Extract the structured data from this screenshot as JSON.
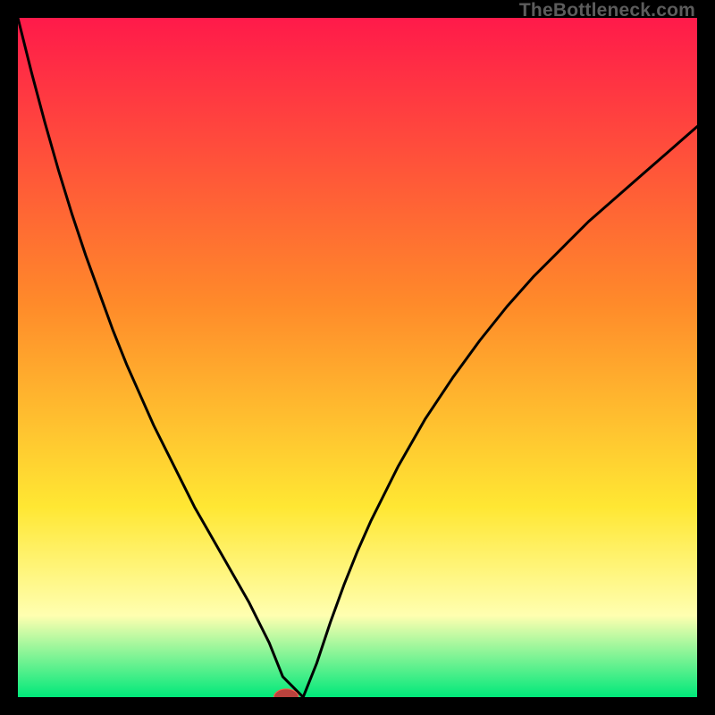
{
  "watermark": "TheBottleneck.com",
  "colors": {
    "gradient_top": "#ff1a4a",
    "gradient_mid1": "#ff8a2a",
    "gradient_mid2": "#ffe733",
    "gradient_paleyellow": "#ffffb0",
    "gradient_green": "#00e87a",
    "curve": "#000000",
    "marker_fill": "#b9423d",
    "marker_stroke": "#ff5a4a",
    "frame_bg": "#000000"
  },
  "chart_data": {
    "type": "line",
    "title": "",
    "xlabel": "",
    "ylabel": "",
    "xlim": [
      0,
      100
    ],
    "ylim": [
      0,
      100
    ],
    "x": [
      0,
      2,
      4,
      6,
      8,
      10,
      12,
      14,
      16,
      18,
      20,
      22,
      24,
      26,
      28,
      30,
      32,
      34,
      35,
      36,
      37,
      38,
      39,
      40,
      42,
      44,
      46,
      48,
      50,
      52,
      54,
      56,
      58,
      60,
      64,
      68,
      72,
      76,
      80,
      84,
      88,
      92,
      96,
      100
    ],
    "series": [
      {
        "name": "bottleneck-curve",
        "values": [
          100,
          92,
          84.5,
          77.5,
          71,
          65,
          59.5,
          54,
          49,
          44.5,
          40,
          36,
          32,
          28,
          24.5,
          21,
          17.5,
          14,
          12,
          10,
          8,
          5.5,
          3,
          0,
          0,
          5,
          11,
          16.5,
          21.5,
          26,
          30,
          34,
          37.5,
          41,
          47,
          52.5,
          57.5,
          62,
          66,
          70,
          73.5,
          77,
          80.5,
          84
        ]
      }
    ],
    "marker": {
      "x": 39.5,
      "y": 0,
      "rx": 1.8,
      "ry": 1.2
    },
    "flat_zone": {
      "x_start": 39,
      "x_end": 42,
      "y": 0
    },
    "grid": false,
    "legend": false
  }
}
